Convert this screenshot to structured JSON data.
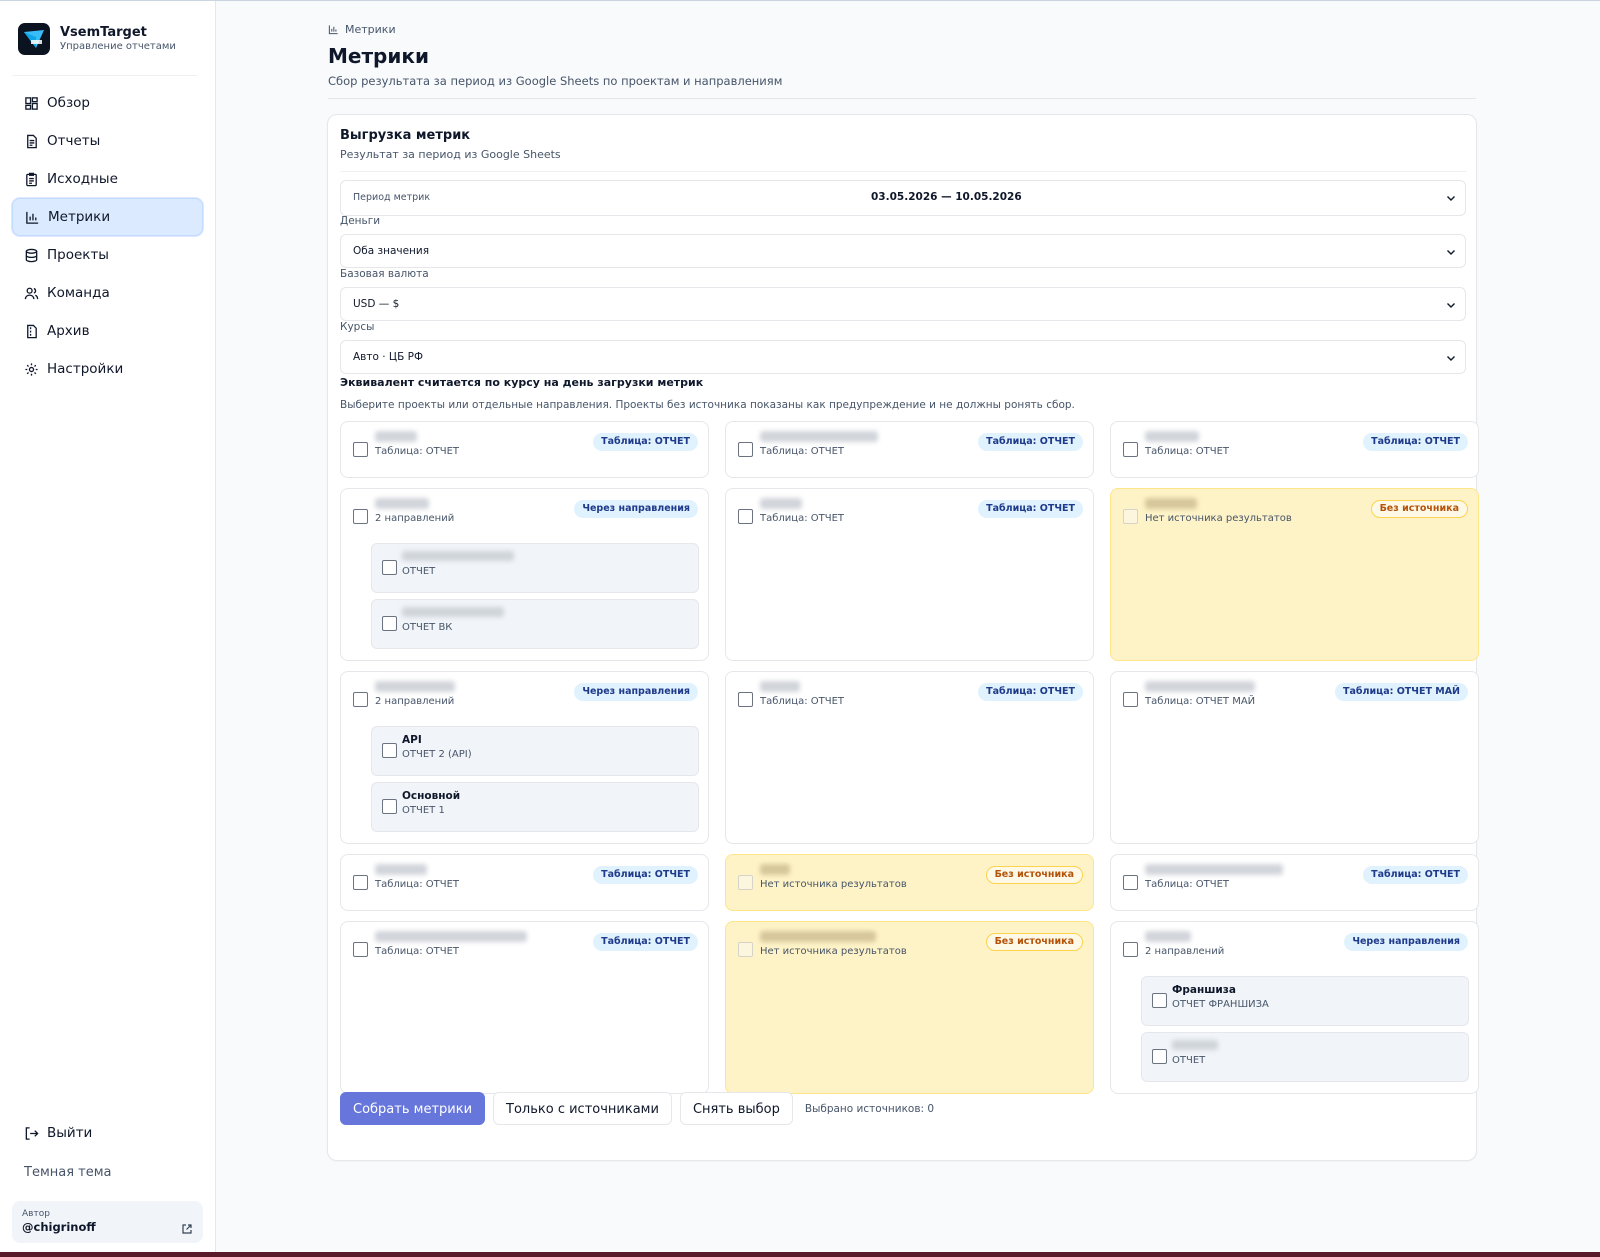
{
  "brand": {
    "name": "VsemTarget",
    "subtitle": "Управление отчетами"
  },
  "nav": [
    {
      "label": "Обзор",
      "icon": "dashboard-icon",
      "active": false
    },
    {
      "label": "Отчеты",
      "icon": "document-icon",
      "active": false
    },
    {
      "label": "Исходные",
      "icon": "clipboard-icon",
      "active": false
    },
    {
      "label": "Метрики",
      "icon": "bar-chart-icon",
      "active": true
    },
    {
      "label": "Проекты",
      "icon": "database-icon",
      "active": false
    },
    {
      "label": "Команда",
      "icon": "users-icon",
      "active": false
    },
    {
      "label": "Архив",
      "icon": "archive-icon",
      "active": false
    },
    {
      "label": "Настройки",
      "icon": "gear-icon",
      "active": false
    }
  ],
  "sidebar_footer": {
    "logout": "Выйти",
    "theme": "Темная тема",
    "author_caption": "Автор",
    "author_name": "@chigrinoff"
  },
  "header": {
    "breadcrumb": "Метрики",
    "title": "Метрики",
    "subtitle": "Сбор результата за период из Google Sheets по проектам и направлениям"
  },
  "card": {
    "title": "Выгрузка метрик",
    "subtitle": "Результат за период из Google Sheets"
  },
  "form": {
    "period_label": "Период метрик",
    "period_value": "03.05.2026 — 10.05.2026",
    "money_label": "Деньги",
    "money_value": "Оба значения",
    "currency_label": "Базовая валюта",
    "currency_value": "USD — $",
    "rates_label": "Курсы",
    "rates_value": "Авто · ЦБ РФ",
    "note_bold": "Эквивалент считается по курсу на день загрузки метрик",
    "note_hint": "Выберите проекты или отдельные направления. Проекты без источника показаны как предупреждение и не должны ронять сбор."
  },
  "tiles": {
    "r1c1": {
      "source": "Таблица: ОТЧЕТ",
      "badge": "Таблица: ОТЧЕТ"
    },
    "r1c2": {
      "source": "Таблица: ОТЧЕТ",
      "badge": "Таблица: ОТЧЕТ"
    },
    "r1c3": {
      "source": "Таблица: ОТЧЕТ",
      "badge": "Таблица: ОТЧЕТ"
    },
    "r2c1": {
      "source": "2 направлений",
      "badge": "Через направления",
      "subs": [
        {
          "name": "",
          "source": "ОТЧЕТ"
        },
        {
          "name": "",
          "source": "ОТЧЕТ ВК"
        }
      ]
    },
    "r2c2": {
      "source": "Таблица: ОТЧЕТ",
      "badge": "Таблица: ОТЧЕТ"
    },
    "r2c3": {
      "source": "Нет источника результатов",
      "badge": "Без источника"
    },
    "r3c1": {
      "source": "2 направлений",
      "badge": "Через направления",
      "subs": [
        {
          "name": "API",
          "source": "ОТЧЕТ 2 (API)"
        },
        {
          "name": "Основной",
          "source": "ОТЧЕТ 1"
        }
      ]
    },
    "r3c2": {
      "source": "Таблица: ОТЧЕТ",
      "badge": "Таблица: ОТЧЕТ"
    },
    "r3c3": {
      "source": "Таблица: ОТЧЕТ МАЙ",
      "badge": "Таблица: ОТЧЕТ МАЙ"
    },
    "r4c1": {
      "source": "Таблица: ОТЧЕТ",
      "badge": "Таблица: ОТЧЕТ"
    },
    "r4c2": {
      "source": "Нет источника результатов",
      "badge": "Без источника"
    },
    "r4c3": {
      "source": "Таблица: ОТЧЕТ",
      "badge": "Таблица: ОТЧЕТ"
    },
    "r5c1": {
      "source": "Таблица: ОТЧЕТ",
      "badge": "Таблица: ОТЧЕТ"
    },
    "r5c2": {
      "source": "Нет источника результатов",
      "badge": "Без источника"
    },
    "r5c3": {
      "source": "2 направлений",
      "badge": "Через направления",
      "subs": [
        {
          "name": "Франшиза",
          "source": "ОТЧЕТ ФРАНШИЗА"
        },
        {
          "name": "",
          "source": "ОТЧЕТ"
        }
      ]
    }
  },
  "actions": {
    "collect": "Собрать метрики",
    "only_sources": "Только с источниками",
    "clear": "Снять выбор",
    "selected_count": "Выбрано источников: 0"
  },
  "colors": {
    "accent": "#6676db",
    "active_nav": "#dbeafe",
    "warning_bg": "#fef3c7",
    "badge_bg": "#e0f2fe"
  }
}
